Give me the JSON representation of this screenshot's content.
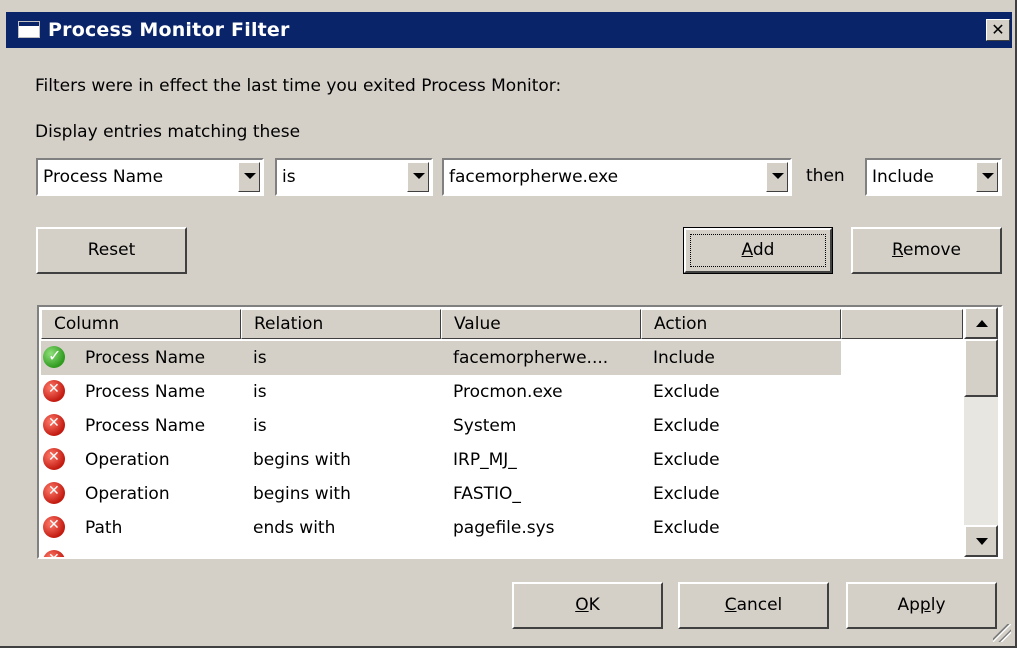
{
  "window": {
    "title": "Process Monitor Filter",
    "close_label": "✕"
  },
  "intro_text": "Filters were in effect the last time you exited Process Monitor:",
  "match_label": "Display entries matching these",
  "filter_row": {
    "column": "Process Name",
    "relation": "is",
    "value": "facemorpherwe.exe",
    "then_label": "then",
    "action": "Include"
  },
  "buttons": {
    "reset": "Reset",
    "add_prefix": "",
    "add_key": "A",
    "add_rest": "dd",
    "remove_key": "R",
    "remove_rest": "emove",
    "ok_key": "O",
    "ok_rest": "K",
    "cancel_key": "C",
    "cancel_rest": "ancel",
    "apply_prefix": "Ap",
    "apply_key": "p",
    "apply_rest": "ly"
  },
  "table": {
    "headers": [
      "Column",
      "Relation",
      "Value",
      "Action"
    ],
    "rows": [
      {
        "icon": "check-icon",
        "column": "Process Name",
        "relation": "is",
        "value": "facemorpherwe....",
        "action": "Include"
      },
      {
        "icon": "exclude-icon",
        "column": "Process Name",
        "relation": "is",
        "value": "Procmon.exe",
        "action": "Exclude"
      },
      {
        "icon": "exclude-icon",
        "column": "Process Name",
        "relation": "is",
        "value": "System",
        "action": "Exclude"
      },
      {
        "icon": "exclude-icon",
        "column": "Operation",
        "relation": "begins with",
        "value": "IRP_MJ_",
        "action": "Exclude"
      },
      {
        "icon": "exclude-icon",
        "column": "Operation",
        "relation": "begins with",
        "value": "FASTIO_",
        "action": "Exclude"
      },
      {
        "icon": "exclude-icon",
        "column": "Path",
        "relation": "ends with",
        "value": "pagefile.sys",
        "action": "Exclude"
      }
    ]
  },
  "colors": {
    "titlebar": "#0a246a",
    "face": "#d4d0c8",
    "include": "#2e9a1e",
    "exclude": "#c31a10"
  }
}
